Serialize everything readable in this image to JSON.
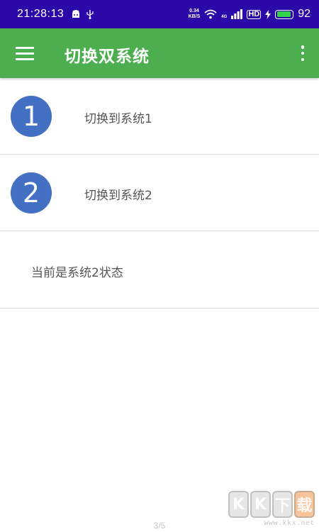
{
  "status_bar": {
    "time": "21:28:13",
    "net_speed_value": "0.34",
    "net_speed_unit": "KB/S",
    "network_type": "4G",
    "hd_label": "HD",
    "battery_level": "92",
    "battery_fill": 0.92,
    "battery_color": "#35d24c",
    "background_color": "#2b08a8"
  },
  "app_bar": {
    "title": "切换双系统",
    "color": "#4cae4f",
    "menu_icon": "hamburger-menu-icon",
    "overflow_icon": "more-vertical-icon"
  },
  "list": {
    "items": [
      {
        "number": "1",
        "label": "切换到系统1"
      },
      {
        "number": "2",
        "label": "切换到系统2"
      }
    ],
    "badge_color": "#4470c4",
    "status_text": "当前是系统2状态"
  },
  "footer": {
    "page_indicator": "3/5"
  },
  "watermark": {
    "letters": [
      "K",
      "K",
      "下",
      "载"
    ],
    "url": "www.kkx.net"
  }
}
